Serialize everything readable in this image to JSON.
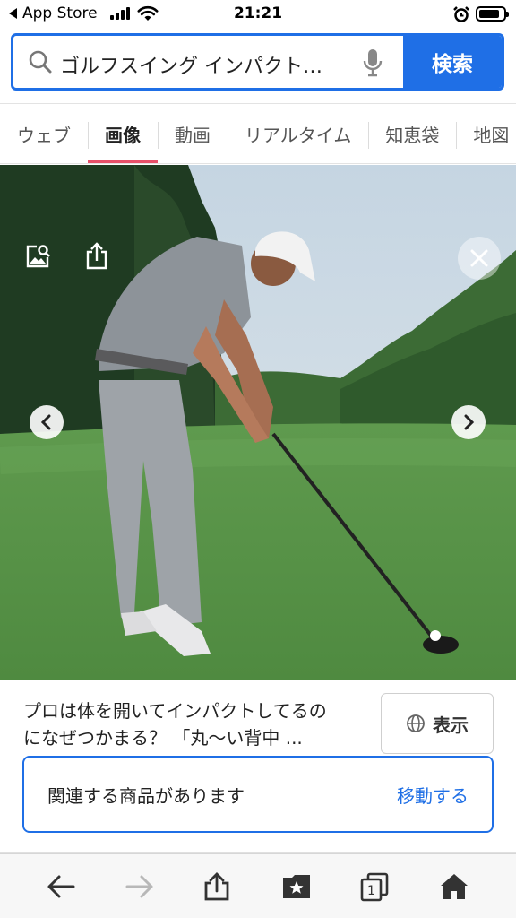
{
  "status_bar": {
    "back_app": "App Store",
    "time": "21:21"
  },
  "search": {
    "query": "ゴルフスイング インパクト…",
    "submit_label": "検索"
  },
  "tabs": [
    {
      "label": "ウェブ",
      "active": false
    },
    {
      "label": "画像",
      "active": true
    },
    {
      "label": "動画",
      "active": false
    },
    {
      "label": "リアルタイム",
      "active": false
    },
    {
      "label": "知恵袋",
      "active": false
    },
    {
      "label": "地図",
      "active": false
    }
  ],
  "image_viewer": {
    "icons": [
      "image-search-icon",
      "share-icon",
      "close-icon",
      "chevron-left-icon",
      "chevron-right-icon"
    ]
  },
  "caption": {
    "line1": "プロは体を開いてインパクトしてるの",
    "line2": "になぜつかまる？ 「丸〜い背中 ..."
  },
  "show_button": {
    "label": "表示",
    "icon": "globe-icon"
  },
  "related": {
    "text": "関連する商品があります",
    "link": "移動する"
  },
  "toolbar": {
    "icons": [
      "back-arrow-icon",
      "forward-arrow-icon",
      "share-icon",
      "bookmarks-icon",
      "tabs-icon",
      "home-icon"
    ],
    "tab_count": "1"
  },
  "colors": {
    "accent": "#1f6fe6",
    "active_tab_underline": "#e8506a"
  }
}
